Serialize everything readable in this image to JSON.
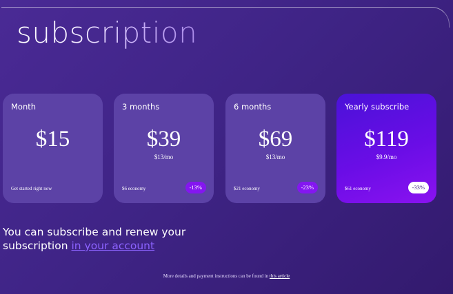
{
  "page": {
    "title": "subscription"
  },
  "plans": [
    {
      "name": "Month",
      "price": "$15",
      "per_month": "",
      "note": "Get started right now",
      "badge": ""
    },
    {
      "name": "3 months",
      "price": "$39",
      "per_month": "$13/mo",
      "note": "$6 economy",
      "badge": "-13%"
    },
    {
      "name": "6 months",
      "price": "$69",
      "per_month": "$13/mo",
      "note": "$21 economy",
      "badge": "-23%"
    },
    {
      "name": "Yearly subscribe",
      "price": "$119",
      "per_month": "$9.9/mo",
      "note": "$61 economy",
      "badge": "-33%"
    }
  ],
  "renew": {
    "text_before": "You can subscribe and renew your subscription ",
    "link_text": "in your account"
  },
  "footer": {
    "text": "More details and payment instructions can be found in ",
    "link_text": "this article"
  },
  "colors": {
    "background": "#3f2486",
    "card": "#5c42a6",
    "card_highlight": "#5a10df",
    "badge": "#8416f0",
    "link": "#8c63ff"
  }
}
